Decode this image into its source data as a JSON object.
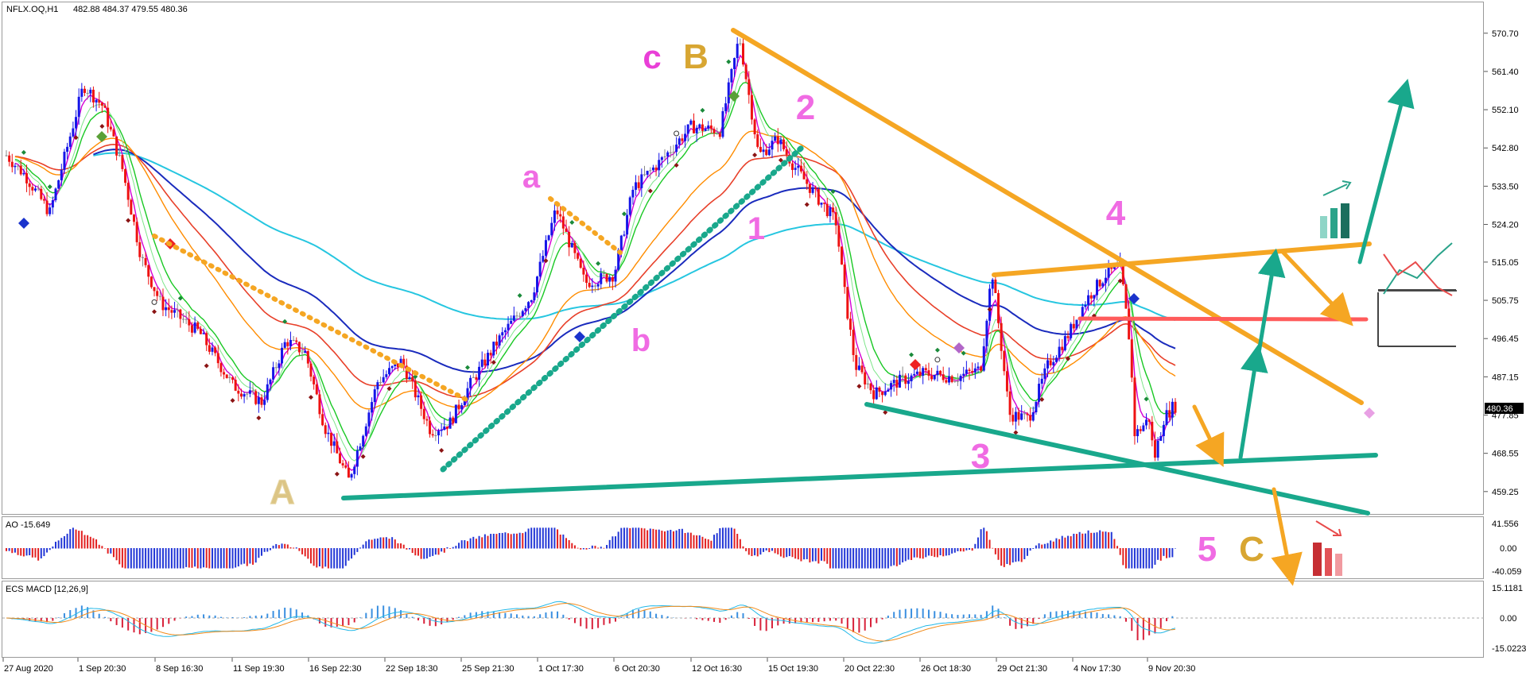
{
  "header": {
    "symbol_label": "NFLX.OQ,H1",
    "ohlc": "482.88 484.37 479.55 480.36"
  },
  "last_price_label": "480.36",
  "ao_panel": {
    "label": "AO -15.649",
    "ticks": [
      "41.556",
      "0.00",
      "-40.059"
    ]
  },
  "macd_panel": {
    "label": "ECS MACD [12,26,9]",
    "ticks": [
      "15.1181",
      "0.00",
      "-15.0223"
    ]
  },
  "x_tick_labels": [
    "27 Aug 2020",
    "1 Sep 20:30",
    "8 Sep 16:30",
    "11 Sep 19:30",
    "16 Sep 22:30",
    "22 Sep 18:30",
    "25 Sep 21:30",
    "1 Oct 17:30",
    "6 Oct 20:30",
    "12 Oct 16:30",
    "15 Oct 19:30",
    "20 Oct 22:30",
    "26 Oct 18:30",
    "29 Oct 21:30",
    "4 Nov 17:30",
    "9 Nov 20:30"
  ],
  "wave_labels": {
    "A": "A",
    "B": "B",
    "C": "C",
    "c": "c",
    "a": "a",
    "b": "b",
    "w1": "1",
    "w2": "2",
    "w3": "3",
    "w4": "4",
    "w5": "5"
  },
  "colors": {
    "bull": "#1515e8",
    "bear": "#ee1212",
    "orange": "#f5a623",
    "teal": "#19a88c",
    "wave_pink": "#e93fd7",
    "wave_gold": "#d8a632",
    "ema_blue": "#1a2bbd",
    "ema_cyan": "#26c6e0",
    "ema_red": "#e8402a",
    "ema_orange": "#ff8c00",
    "ema_green": "#19c824",
    "magenta": "#d400d4",
    "hline_red": "#ff4d4d"
  },
  "chart_data": {
    "type": "candlestick",
    "symbol": "NFLX.OQ",
    "timeframe": "H1",
    "ylim": [
      454.0,
      578.0
    ],
    "y_ticks": [
      459.25,
      468.55,
      477.85,
      487.15,
      496.45,
      505.75,
      515.05,
      524.2,
      533.5,
      542.8,
      552.1,
      561.4,
      570.7
    ],
    "price_path": [
      [
        0,
        541
      ],
      [
        20,
        536
      ],
      [
        45,
        527
      ],
      [
        80,
        558
      ],
      [
        100,
        553
      ],
      [
        120,
        538
      ],
      [
        140,
        516
      ],
      [
        160,
        505
      ],
      [
        200,
        498
      ],
      [
        235,
        485
      ],
      [
        265,
        481
      ],
      [
        290,
        496
      ],
      [
        310,
        493
      ],
      [
        330,
        475
      ],
      [
        355,
        462
      ],
      [
        385,
        486
      ],
      [
        410,
        491
      ],
      [
        440,
        474
      ],
      [
        460,
        476
      ],
      [
        480,
        485
      ],
      [
        510,
        496
      ],
      [
        545,
        507
      ],
      [
        570,
        528
      ],
      [
        600,
        510
      ],
      [
        630,
        512
      ],
      [
        650,
        533
      ],
      [
        680,
        540
      ],
      [
        710,
        548
      ],
      [
        740,
        547
      ],
      [
        760,
        570
      ],
      [
        780,
        541
      ],
      [
        800,
        545
      ],
      [
        815,
        539
      ],
      [
        840,
        531
      ],
      [
        860,
        525
      ],
      [
        870,
        506
      ],
      [
        880,
        490
      ],
      [
        900,
        483
      ],
      [
        925,
        486
      ],
      [
        950,
        488
      ],
      [
        985,
        487
      ],
      [
        1010,
        489
      ],
      [
        1022,
        513
      ],
      [
        1040,
        478
      ],
      [
        1060,
        477
      ],
      [
        1080,
        490
      ],
      [
        1100,
        497
      ],
      [
        1120,
        506
      ],
      [
        1140,
        512
      ],
      [
        1155,
        514
      ],
      [
        1165,
        495
      ],
      [
        1170,
        473
      ],
      [
        1185,
        477
      ],
      [
        1190,
        467
      ],
      [
        1200,
        477
      ],
      [
        1210,
        480
      ]
    ],
    "x_span": [
      0,
      1212
    ],
    "ao_range": [
      -40.059,
      41.556
    ],
    "macd_range": [
      -15.0223,
      15.1181
    ]
  }
}
